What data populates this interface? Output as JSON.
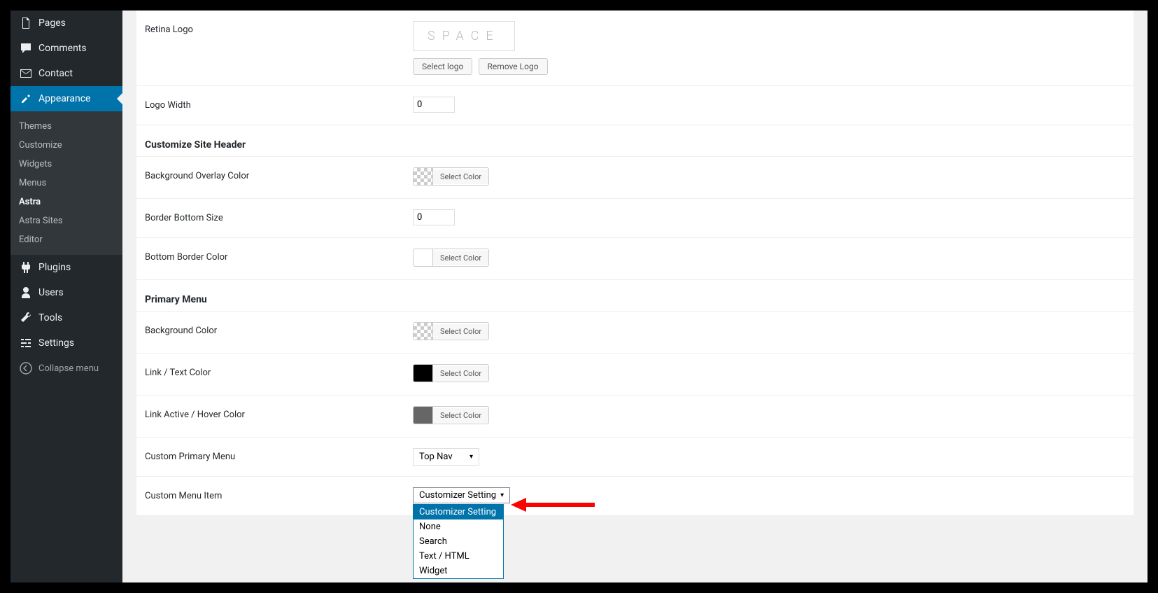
{
  "sidebar": {
    "pages": "Pages",
    "comments": "Comments",
    "contact": "Contact",
    "appearance": "Appearance",
    "appearance_sub": [
      "Themes",
      "Customize",
      "Widgets",
      "Menus",
      "Astra",
      "Astra Sites",
      "Editor"
    ],
    "plugins": "Plugins",
    "users": "Users",
    "tools": "Tools",
    "settings": "Settings",
    "collapse": "Collapse menu"
  },
  "form": {
    "retina_logo_label": "Retina Logo",
    "logo_text": "SPACE",
    "select_logo_btn": "Select logo",
    "remove_logo_btn": "Remove Logo",
    "logo_width_label": "Logo Width",
    "logo_width_value": "0",
    "section_header": "Customize Site Header",
    "bg_overlay_label": "Background Overlay Color",
    "border_bottom_label": "Border Bottom Size",
    "border_bottom_value": "0",
    "bottom_border_color_label": "Bottom Border Color",
    "section_primary": "Primary Menu",
    "bg_color_label": "Background Color",
    "link_text_color_label": "Link / Text Color",
    "link_active_color_label": "Link Active / Hover Color",
    "custom_primary_menu_label": "Custom Primary Menu",
    "custom_primary_menu_value": "Top Nav",
    "custom_menu_item_label": "Custom Menu Item",
    "custom_menu_item_value": "Customizer Setting",
    "select_color_btn": "Select Color",
    "dropdown_options": [
      "Customizer Setting",
      "None",
      "Search",
      "Text / HTML",
      "Widget"
    ]
  }
}
